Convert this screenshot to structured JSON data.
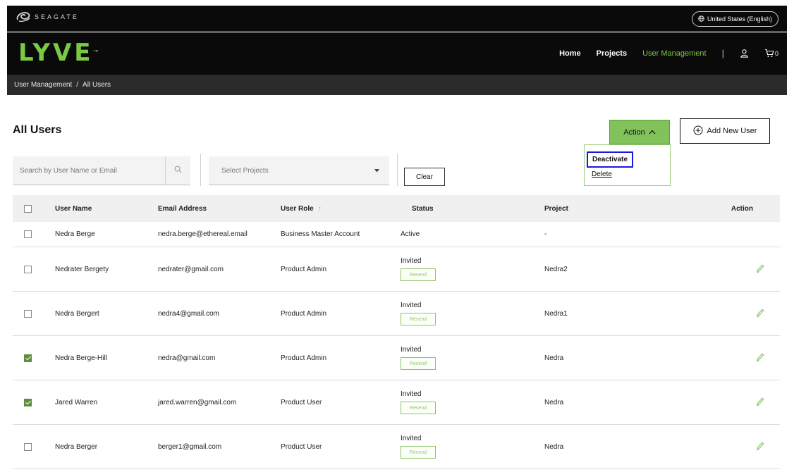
{
  "topbar": {
    "brand_text": "SEAGATE",
    "language": "United States (English)"
  },
  "navbar": {
    "logo": "LYVE",
    "logo_mark": "™",
    "links": [
      {
        "label": "Home"
      },
      {
        "label": "Projects"
      },
      {
        "label": "User Management"
      }
    ],
    "separator": "|",
    "cart_count": "0"
  },
  "breadcrumb": {
    "items": [
      "User Management",
      "All Users"
    ],
    "separator": "/"
  },
  "page": {
    "title": "All Users"
  },
  "toolbar": {
    "action_label": "Action",
    "add_user_label": "Add New User",
    "search_placeholder": "Search by User Name or Email",
    "select_projects_label": "Select Projects",
    "clear_label": "Clear"
  },
  "action_menu": {
    "items": [
      {
        "label": "Deactivate"
      },
      {
        "label": "Delete"
      }
    ]
  },
  "table": {
    "headers": {
      "name": "User Name",
      "email": "Email Address",
      "role": "User Role",
      "status": "Status",
      "project": "Project",
      "action": "Action"
    },
    "resend_label": "Resend",
    "rows": [
      {
        "checked": false,
        "name": "Nedra Berge",
        "email": "nedra.berge@ethereal.email",
        "role": "Business Master Account",
        "status": "Active",
        "project": "-",
        "resend": false,
        "editable": false
      },
      {
        "checked": false,
        "name": "Nedrater Bergety",
        "email": "nedrater@gmail.com",
        "role": "Product Admin",
        "status": "Invited",
        "project": "Nedra2",
        "resend": true,
        "editable": true
      },
      {
        "checked": false,
        "name": "Nedra Bergert",
        "email": "nedra4@gmail.com",
        "role": "Product Admin",
        "status": "Invited",
        "project": "Nedra1",
        "resend": true,
        "editable": true
      },
      {
        "checked": true,
        "name": "Nedra Berge-Hill",
        "email": "nedra@gmail.com",
        "role": "Product Admin",
        "status": "Invited",
        "project": "Nedra",
        "resend": true,
        "editable": true
      },
      {
        "checked": true,
        "name": "Jared Warren",
        "email": "jared.warren@gmail.com",
        "role": "Product User",
        "status": "Invited",
        "project": "Nedra",
        "resend": true,
        "editable": true
      },
      {
        "checked": false,
        "name": "Nedra Berger",
        "email": "berger1@gmail.com",
        "role": "Product User",
        "status": "Invited",
        "project": "Nedra",
        "resend": true,
        "editable": true
      }
    ]
  },
  "colors": {
    "brand_green": "#7ac943",
    "action_green": "#82c25a",
    "highlight_blue": "#1a1adb",
    "checkbox_checked": "#5c8f3a"
  }
}
